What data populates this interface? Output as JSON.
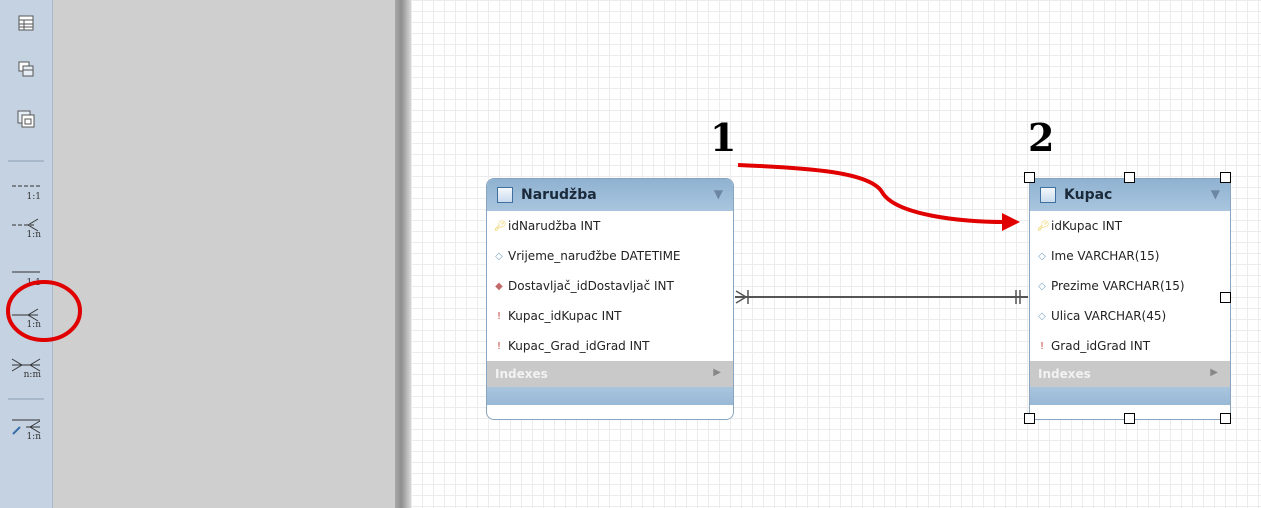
{
  "toolbar": {
    "tools": [
      {
        "name": "table-tool",
        "label": ""
      },
      {
        "name": "view-tool",
        "label": ""
      },
      {
        "name": "routine-group-tool",
        "label": ""
      },
      {
        "name": "relation-1-1-nonidentifying",
        "label": "1:1"
      },
      {
        "name": "relation-1-n-nonidentifying",
        "label": "1:n"
      },
      {
        "name": "relation-1-1-identifying",
        "label": "1:1"
      },
      {
        "name": "relation-1-n-identifying",
        "label": "1:n"
      },
      {
        "name": "relation-n-m",
        "label": "n:m"
      },
      {
        "name": "relation-1-n-existing-columns",
        "label": "1:n"
      }
    ]
  },
  "annotations": {
    "label_1": "1",
    "label_2": "2",
    "highlight_color": "#e00000"
  },
  "tables": {
    "narudzba": {
      "title": "Narudžba",
      "columns": [
        {
          "text": "idNarudžba INT",
          "icon": "primary-key-icon"
        },
        {
          "text": "Vrijeme_naruđžbe DATETIME",
          "icon": "column-diamond-icon"
        },
        {
          "text": "Dostavljač_idDostavljač INT",
          "icon": "foreign-key-diamond-icon"
        },
        {
          "text": "Kupac_idKupac INT",
          "icon": "foreign-key-icon"
        },
        {
          "text": "Kupac_Grad_idGrad INT",
          "icon": "foreign-key-icon"
        }
      ],
      "indexes_label": "Indexes"
    },
    "kupac": {
      "title": "Kupac",
      "columns": [
        {
          "text": "idKupac INT",
          "icon": "primary-key-icon"
        },
        {
          "text": "Ime VARCHAR(15)",
          "icon": "column-diamond-icon"
        },
        {
          "text": "Prezime VARCHAR(15)",
          "icon": "column-diamond-icon"
        },
        {
          "text": "Ulica VARCHAR(45)",
          "icon": "column-diamond-icon"
        },
        {
          "text": "Grad_idGrad INT",
          "icon": "foreign-key-icon"
        }
      ],
      "indexes_label": "Indexes"
    }
  }
}
